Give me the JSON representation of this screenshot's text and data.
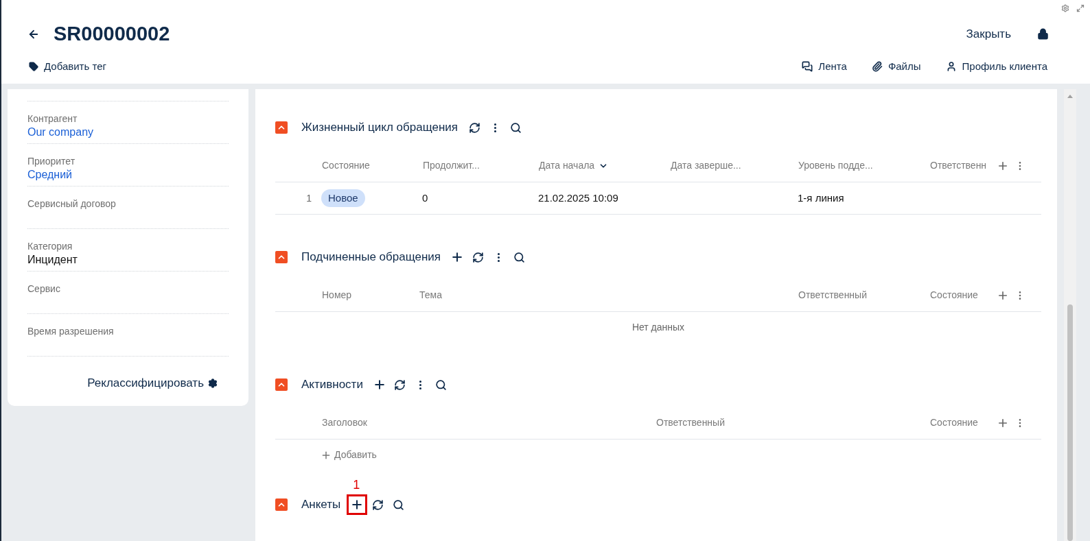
{
  "window_controls": [
    {
      "kind": "settings"
    },
    {
      "kind": "expand"
    }
  ],
  "header": {
    "title": "SR00000002",
    "add_tag": "Добавить тег",
    "close": "Закрыть",
    "actions": [
      {
        "kind": "feed",
        "label": "Лента"
      },
      {
        "kind": "files",
        "label": "Файлы"
      },
      {
        "kind": "profile",
        "label": "Профиль клиента"
      }
    ]
  },
  "sidebar": {
    "fields": [
      {
        "label": "Контрагент",
        "value": "Our company",
        "link": true
      },
      {
        "label": "Приоритет",
        "value": "Средний",
        "link": true
      },
      {
        "label": "Сервисный договор"
      },
      {
        "label": "Категория",
        "value": "Инцидент",
        "link": false
      },
      {
        "label": "Сервис"
      },
      {
        "label": "Время разрешения"
      }
    ],
    "reclassify": "Реклассифицировать"
  },
  "sections": [
    {
      "title": "Жизненный цикл обращения",
      "expanded": true,
      "tools": [
        {
          "kind": "refresh"
        },
        {
          "kind": "more"
        },
        {
          "kind": "search"
        }
      ],
      "columns": [
        {
          "label": "Состояние"
        },
        {
          "label": "Продолжит..."
        },
        {
          "label": "Дата начала",
          "sorted": true
        },
        {
          "label": "Дата заверше..."
        },
        {
          "label": "Уровень подде..."
        },
        {
          "label": "Ответственн"
        }
      ],
      "rows": [
        {
          "number": "1",
          "cells": [
            {
              "kind": "tag",
              "text": "Новое"
            },
            {
              "kind": "text",
              "text": "0"
            },
            {
              "kind": "text",
              "text": "21.02.2025 10:09"
            },
            {},
            {
              "kind": "text",
              "text": "1-я линия"
            },
            {}
          ]
        }
      ]
    },
    {
      "title": "Подчиненные обращения",
      "expanded": true,
      "tools": [
        {
          "kind": "add"
        },
        {
          "kind": "refresh"
        },
        {
          "kind": "more"
        },
        {
          "kind": "search"
        }
      ],
      "columns": [
        {
          "label": "Номер"
        },
        {
          "label": "Тема"
        },
        {
          "label": "Ответственный"
        },
        {
          "label": "Состояние"
        }
      ],
      "empty": "Нет данных"
    },
    {
      "title": "Активности",
      "expanded": true,
      "tools": [
        {
          "kind": "add"
        },
        {
          "kind": "refresh"
        },
        {
          "kind": "more"
        },
        {
          "kind": "search"
        }
      ],
      "columns": [
        {
          "label": "Заголовок"
        },
        {
          "label": "Ответственный"
        },
        {
          "label": "Состояние"
        }
      ],
      "add_row": "Добавить"
    },
    {
      "title": "Анкеты",
      "expanded": true,
      "tools": [
        {
          "kind": "add",
          "callout": "1"
        },
        {
          "kind": "refresh"
        },
        {
          "kind": "search"
        }
      ]
    }
  ]
}
